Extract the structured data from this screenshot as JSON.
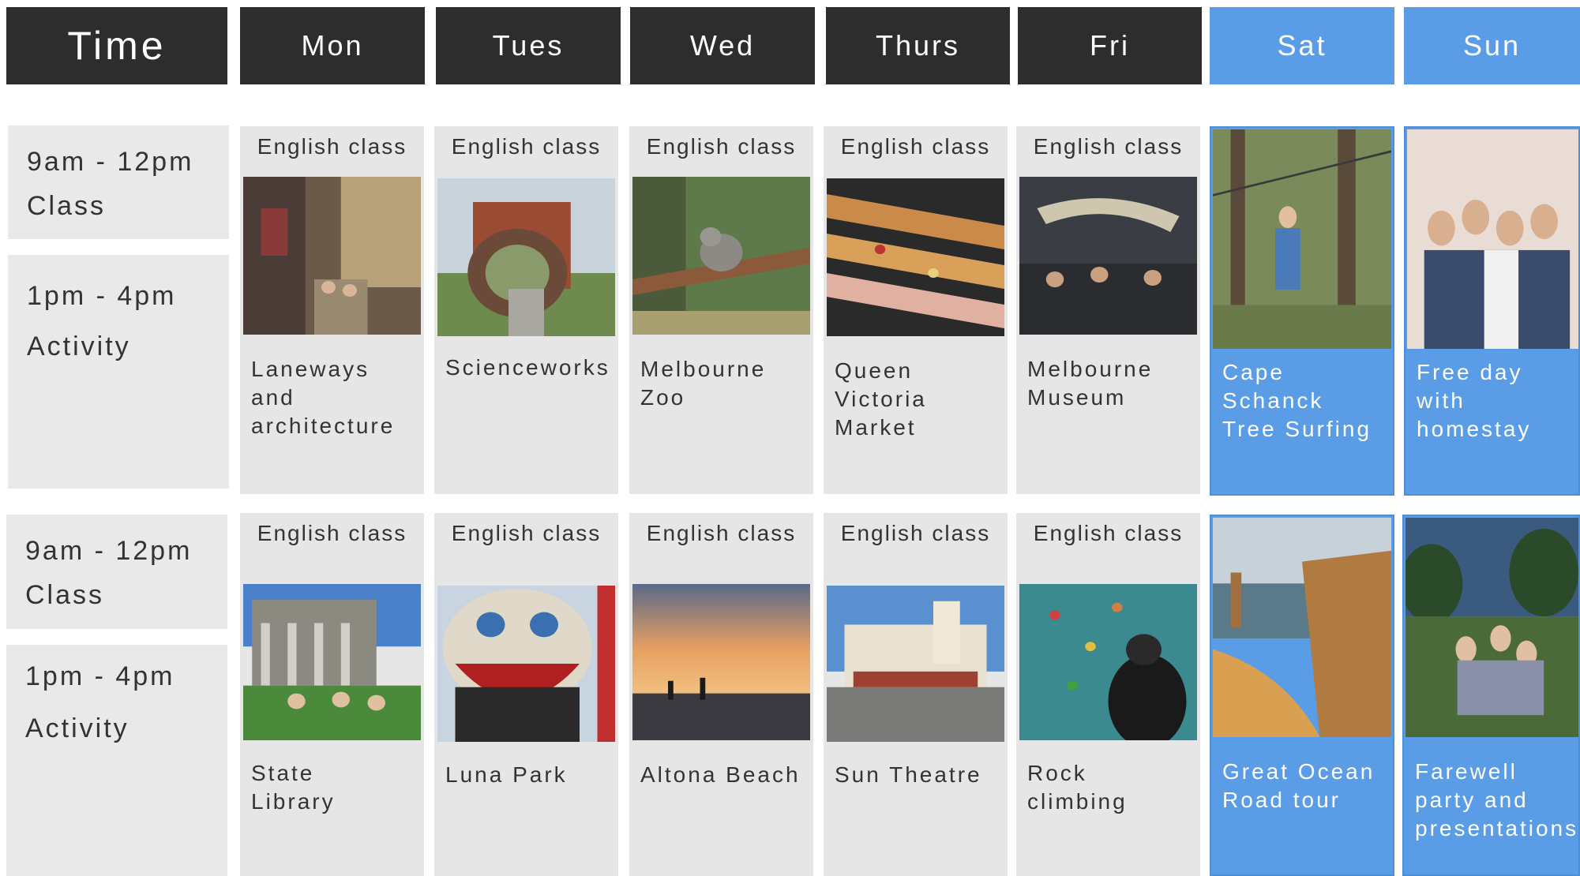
{
  "header": {
    "time": "Time",
    "days": [
      "Mon",
      "Tues",
      "Wed",
      "Thurs",
      "Fri",
      "Sat",
      "Sun"
    ]
  },
  "rows": [
    {
      "class_time": "9am - 12pm",
      "class_label": "Class",
      "activity_time": "1pm - 4pm",
      "activity_label": "Activity",
      "cells": [
        {
          "class": "English class",
          "activity": "Laneways\nand\narchitecture"
        },
        {
          "class": "English class",
          "activity": "Scienceworks"
        },
        {
          "class": "English class",
          "activity": "Melbourne\nZoo"
        },
        {
          "class": "English class",
          "activity": "Queen\nVictoria\nMarket"
        },
        {
          "class": "English class",
          "activity": "Melbourne\nMuseum"
        },
        {
          "activity": "Cape\nSchanck\nTree Surfing"
        },
        {
          "activity": "Free day\nwith\nhomestay"
        }
      ]
    },
    {
      "class_time": "9am - 12pm",
      "class_label": "Class",
      "activity_time": "1pm - 4pm",
      "activity_label": "Activity",
      "cells": [
        {
          "class": "English class",
          "activity": "State\nLibrary"
        },
        {
          "class": "English class",
          "activity": "Luna Park"
        },
        {
          "class": "English class",
          "activity": "Altona Beach"
        },
        {
          "class": "English class",
          "activity": "Sun Theatre"
        },
        {
          "class": "English class",
          "activity": "Rock\nclimbing"
        },
        {
          "activity": "Great Ocean\nRoad tour"
        },
        {
          "activity": "Farewell\nparty and\npresentations"
        }
      ]
    }
  ],
  "colors": {
    "header_dark": "#2d2d2d",
    "weekend_blue": "#5a9de6",
    "cell_grey": "#e6e6e6",
    "text_dark": "#333333"
  }
}
